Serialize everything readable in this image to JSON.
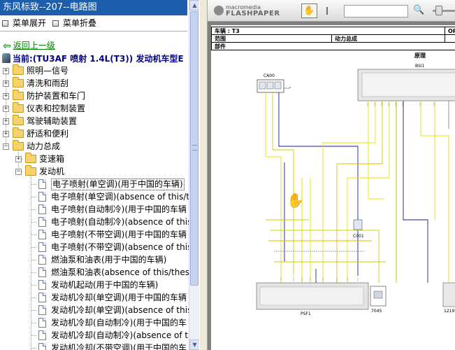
{
  "window": {
    "title": "东风标致--207--电路图"
  },
  "menu": {
    "expand_label": "菜单展开",
    "collapse_label": "菜单折叠"
  },
  "nav": {
    "back_label": "返回上一级",
    "current_label": "当前:(TU3AF 喷射 1.4L(T3)) 发动机车型E"
  },
  "tree": {
    "top_folders": [
      "照明—信号",
      "清洗和雨刮",
      "防护装置和车门",
      "仪表和控制装置",
      "驾驶辅助装置",
      "舒适和便利",
      "动力总成"
    ],
    "sub_folders": [
      "变速箱",
      "发动机"
    ],
    "items": [
      "电子喷射(单空调)(用于中国的车辆)",
      "电子喷射(单空调)(absence of this/t",
      "电子喷射(自动制冷)(用于中国的车辆",
      "电子喷射(自动制冷)(absence of this",
      "电子喷射(不带空调)(用于中国的车辆",
      "电子喷射(不带空调)(absence of this",
      "燃油泵和油表(用于中国的车辆)",
      "燃油泵和油表(absence of this/these",
      "发动机起动(用于中国的车辆)",
      "发动机冷却(单空调)(用于中国的车辆",
      "发动机冷却(单空调)(absence of this",
      "发动机冷却(自动制冷)(用于中国的车",
      "发动机冷却(自动制冷)(absence of th",
      "发动机冷却(不带空调)(用于中国的车"
    ],
    "selected_index": 0
  },
  "viewer": {
    "logo_small": "macromedia",
    "logo_big": "FLASHPAPER",
    "hand_icon": "✋",
    "text_tool_icon": "I",
    "search_icon": "🔍",
    "zoom_level": 0.1
  },
  "doc": {
    "header": {
      "vehicle_label": "车辆 : T3",
      "scope_label": "范围",
      "section_label": "动力总成",
      "parts_label": "部件",
      "op_label": "OP",
      "type_label": "原理"
    },
    "components": [
      "BSI1",
      "CA00",
      "C001",
      "PSF1",
      "7045",
      "1219"
    ]
  },
  "colors": {
    "title_bar": "#1b5eab",
    "link_green": "#008000",
    "current_blue": "#00008b",
    "viewer_bg": "#808080"
  }
}
